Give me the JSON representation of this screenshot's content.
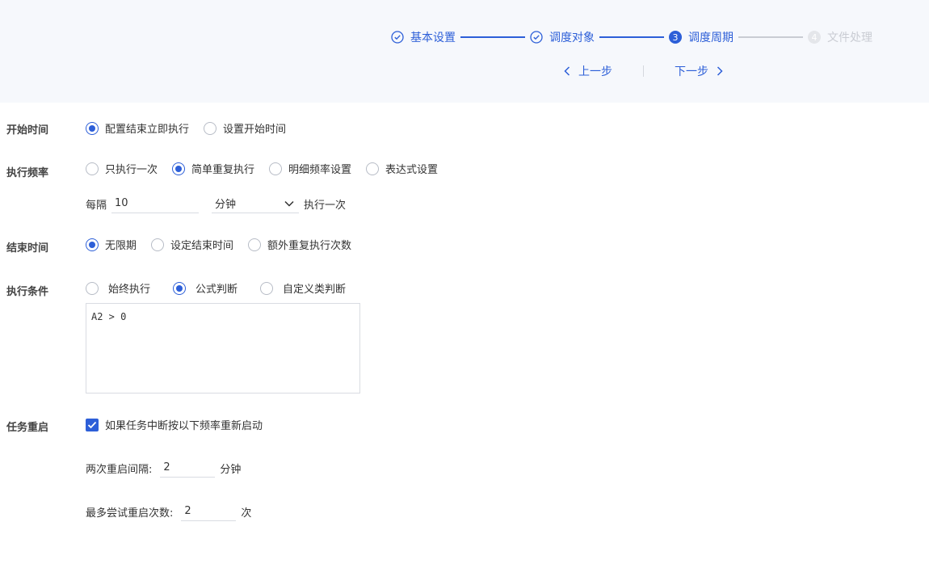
{
  "steps": [
    {
      "label": "基本设置",
      "state": "done"
    },
    {
      "label": "调度对象",
      "state": "done"
    },
    {
      "label": "调度周期",
      "state": "active",
      "num": "3"
    },
    {
      "label": "文件处理",
      "state": "pending",
      "num": "4"
    }
  ],
  "nav": {
    "prev": "上一步",
    "next": "下一步"
  },
  "start_time": {
    "label": "开始时间",
    "options": [
      "配置结束立即执行",
      "设置开始时间"
    ],
    "selected": 0
  },
  "frequency": {
    "label": "执行频率",
    "options": [
      "只执行一次",
      "简单重复执行",
      "明细频率设置",
      "表达式设置"
    ],
    "selected": 1,
    "every_prefix": "每隔",
    "every_value": "10",
    "unit": "分钟",
    "suffix": "执行一次"
  },
  "end_time": {
    "label": "结束时间",
    "options": [
      "无限期",
      "设定结束时间",
      "额外重复执行次数"
    ],
    "selected": 0
  },
  "condition": {
    "label": "执行条件",
    "options": [
      "始终执行",
      "公式判断",
      "自定义类判断"
    ],
    "selected": 1,
    "formula": "A2 > 0"
  },
  "restart": {
    "label": "任务重启",
    "checkbox_label": "如果任务中断按以下频率重新启动",
    "checked": true,
    "interval_label": "两次重启间隔:",
    "interval_value": "2",
    "interval_unit": "分钟",
    "max_label": "最多尝试重启次数:",
    "max_value": "2",
    "max_unit": "次"
  },
  "colors": {
    "accent": "#2d5fd8",
    "header_bg": "#f6f8fc",
    "pending": "#c9ccd3"
  }
}
